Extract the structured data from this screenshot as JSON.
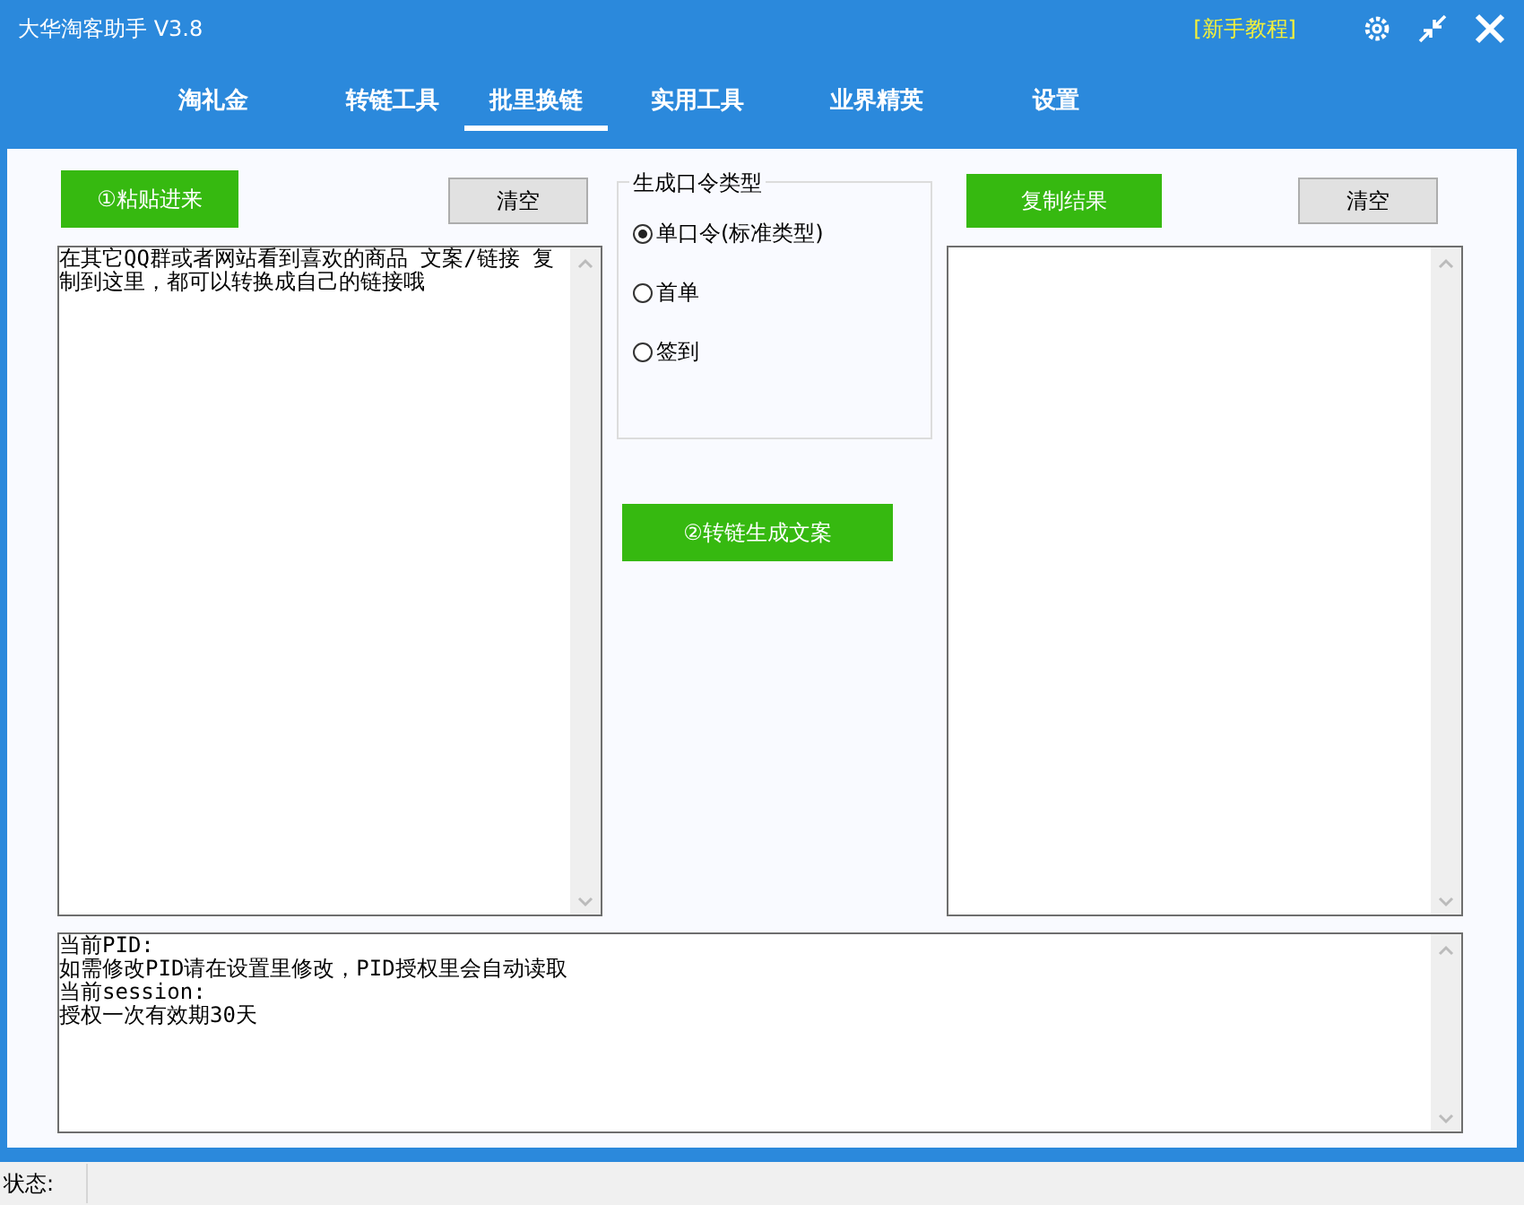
{
  "window": {
    "title": "大华淘客助手 V3.8",
    "help_link": "[新手教程]"
  },
  "tabs": [
    {
      "label": "淘礼金",
      "selected": false
    },
    {
      "label": "转链工具",
      "selected": false
    },
    {
      "label": "批里换链",
      "selected": true
    },
    {
      "label": "实用工具",
      "selected": false
    },
    {
      "label": "业界精英",
      "selected": false
    },
    {
      "label": "设置",
      "selected": false
    }
  ],
  "input_panel": {
    "paste_button": "①粘贴进来",
    "clear_button": "清空",
    "text": "在其它QQ群或者网站看到喜欢的商品 文案/链接 复制到这里，都可以转换成自己的链接哦"
  },
  "options": {
    "title": "生成口令类型",
    "items": [
      {
        "label": "单口令(标准类型)",
        "selected": true
      },
      {
        "label": "首单",
        "selected": false
      },
      {
        "label": "签到",
        "selected": false
      }
    ],
    "convert_button": "②转链生成文案"
  },
  "output_panel": {
    "copy_button": "复制结果",
    "clear_button": "清空"
  },
  "log": {
    "lines": [
      "当前PID:",
      "如需修改PID请在设置里修改，PID授权里会自动读取",
      "当前session:",
      "授权一次有效期30天"
    ]
  },
  "status_bar": {
    "label": "状态:"
  }
}
